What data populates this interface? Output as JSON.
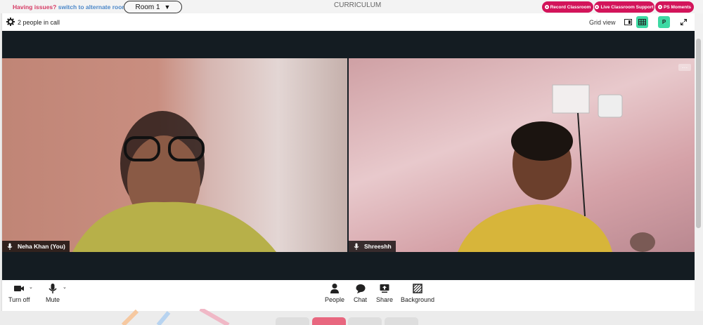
{
  "topbar": {
    "issue_text": "Having issues?",
    "issue_link": "switch to alternate room",
    "room_label": "Room 1",
    "room_caret": "▼",
    "curriculum": "CURRICULUM",
    "buttons": [
      "Record Classroom",
      "Live Classroom Support",
      "PS Moments"
    ]
  },
  "call": {
    "people_count": "2 people in call",
    "view_label": "Grid view",
    "participant_initial": "P"
  },
  "participants": [
    {
      "name": "Neha Khan (You)"
    },
    {
      "name": "Shreeshh"
    }
  ],
  "controls": {
    "camera": "Turn off",
    "mic": "Mute",
    "people": "People",
    "chat": "Chat",
    "share": "Share",
    "background": "Background"
  },
  "colors": {
    "accent_pink": "#d3145a",
    "accent_green": "#3dd9a3",
    "stage_bg": "#141c22"
  }
}
